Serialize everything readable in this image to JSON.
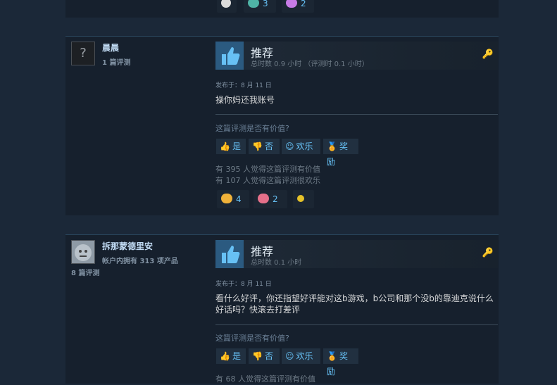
{
  "colors": {
    "background": "#1b2838",
    "card": "#16202d",
    "accent": "#66c0f4",
    "thumb": "#2b5a80"
  },
  "top_reactions": [
    {
      "icon": "award-icon",
      "count": ""
    },
    {
      "icon": "cat-icon",
      "count": "3"
    },
    {
      "icon": "flower-icon",
      "count": "2"
    }
  ],
  "reviews": [
    {
      "username": "晨晨",
      "review_count": "1 篇评测",
      "avatar": "question-avatar",
      "recommend": "推荐",
      "hours": "总时数 0.9 小时 （评测时 0.1 小时）",
      "posted": "发布于：8 月 11 日",
      "text": "操你妈还我账号",
      "helpful_q": "这篇评测是否有价值?",
      "buttons": {
        "yes": "是",
        "no": "否",
        "funny": "欢乐",
        "award": "奖励"
      },
      "helpful_stat": "有 395 人觉得这篇评测有价值",
      "funny_stat": "有 107 人觉得这篇评测很欢乐",
      "reactions": [
        {
          "icon": "laughing-emoji-icon",
          "count": "4"
        },
        {
          "icon": "heart-hands-icon",
          "count": "2"
        },
        {
          "icon": "sparkle-icon",
          "count": ""
        }
      ]
    },
    {
      "username": "拆那蒙德里安",
      "products": "帐户内拥有 313 项产品",
      "review_count": "8 篇评测",
      "avatar": "face-avatar",
      "recommend": "推荐",
      "hours": "总时数 0.1 小时",
      "posted": "发布于：8 月 11 日",
      "text": "看什么好评，你还指望好评能对这b游戏，b公司和那个没b的靠迪克说什么好话吗？快滚去打差评",
      "helpful_q": "这篇评测是否有价值?",
      "buttons": {
        "yes": "是",
        "no": "否",
        "funny": "欢乐",
        "award": "奖励"
      },
      "helpful_stat": "有 68 人觉得这篇评测有价值"
    }
  ]
}
